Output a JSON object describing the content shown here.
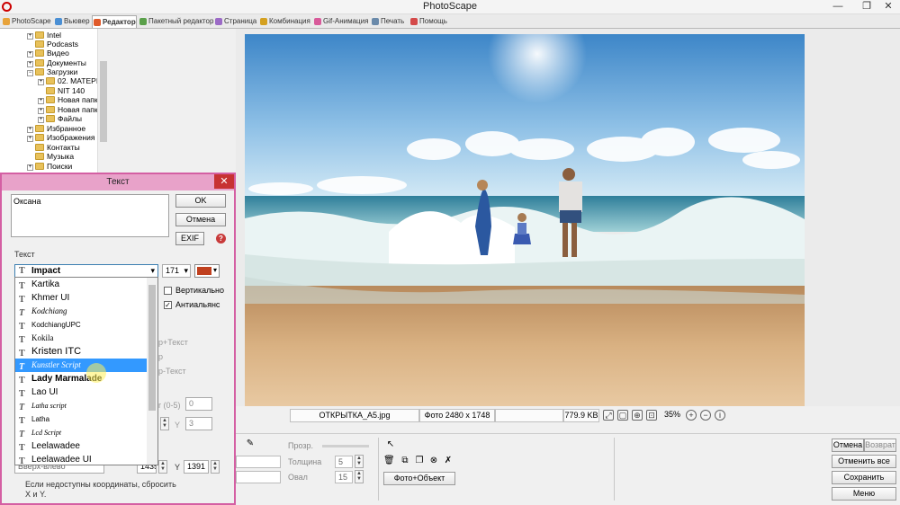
{
  "window": {
    "title": "PhotoScape",
    "minimize": "—",
    "maximize": "❐",
    "close": "✕"
  },
  "tabs": [
    {
      "label": "PhotoScape",
      "icon": "photoscape-icon"
    },
    {
      "label": "Вьювер",
      "icon": "viewer-icon"
    },
    {
      "label": "Редактор",
      "icon": "editor-icon",
      "active": true
    },
    {
      "label": "Пакетный редактор",
      "icon": "batch-icon"
    },
    {
      "label": "Страница",
      "icon": "page-icon"
    },
    {
      "label": "Комбинация",
      "icon": "combine-icon"
    },
    {
      "label": "Gif-Анимация",
      "icon": "gif-icon"
    },
    {
      "label": "Печать",
      "icon": "print-icon"
    },
    {
      "label": "Помощь",
      "icon": "help-icon"
    }
  ],
  "tree": [
    {
      "label": "Intel",
      "expander": "+"
    },
    {
      "label": "Podcasts",
      "expander": ""
    },
    {
      "label": "Видео",
      "expander": "+"
    },
    {
      "label": "Документы",
      "expander": "+"
    },
    {
      "label": "Загрузки",
      "expander": "−"
    },
    {
      "label": "02. MATEPI",
      "expander": "+"
    },
    {
      "label": "NIT 140",
      "expander": ""
    },
    {
      "label": "Новая папк",
      "expander": "+"
    },
    {
      "label": "Новая папк",
      "expander": "+"
    },
    {
      "label": "Файлы",
      "expander": "+"
    },
    {
      "label": "Избранное",
      "expander": "+"
    },
    {
      "label": "Изображения",
      "expander": "+"
    },
    {
      "label": "Контакты",
      "expander": ""
    },
    {
      "label": "Музыка",
      "expander": ""
    },
    {
      "label": "Поиски",
      "expander": "+"
    }
  ],
  "status": {
    "filename": "ОТКРЫТКА_А5.jpg",
    "dimensions": "Фото 2480 x 1748",
    "filesize": "779.9 KB",
    "zoom": "35%"
  },
  "bottom": {
    "transparency_label": "Прозр.",
    "thickness_label": "Толщина",
    "thickness_value": "5",
    "oval_label": "Овал",
    "oval_value": "15",
    "photo_object_button": "Фото+Объект",
    "undo_button": "Отмена",
    "redo_button": "Возврат",
    "undo_all_button": "Отменить все",
    "save_button": "Сохранить",
    "menu_button": "Меню"
  },
  "dialog": {
    "title": "Текст",
    "close": "✕",
    "text_value": "Оксана",
    "ok_button": "OK",
    "cancel_button": "Отмена",
    "exif_button": "EXIF",
    "help_icon": "?",
    "section_label": "Текст",
    "font_value": "Impact",
    "size_value": "171",
    "color": "#c0401e",
    "vertical_label": "Вертикально",
    "antialias_label": "Антиальянс",
    "vertical_checked": false,
    "antialias_checked": true,
    "behind_text_1": "р+Текст",
    "behind_text_2": "р",
    "behind_text_3": "р-Текст",
    "range_label": "r (0-5)",
    "range_value": "0",
    "y_label_1": "Y",
    "y_value_1": "3",
    "position_value": "Вверх-влево",
    "x_value": "1435",
    "y_label_2": "Y",
    "y_value_2": "1391",
    "note": "Если недоступны координаты, сбросить X и Y."
  },
  "fonts": [
    {
      "label": "Kartika"
    },
    {
      "label": "Khmer UI"
    },
    {
      "label": "Kodchiang"
    },
    {
      "label": "KodchiangUPC"
    },
    {
      "label": "Kokila"
    },
    {
      "label": "Kristen ITC"
    },
    {
      "label": "Kunstler Script",
      "selected": true
    },
    {
      "label": "Lady Marmalade"
    },
    {
      "label": "Lao UI"
    },
    {
      "label": "Latha script"
    },
    {
      "label": "Latha"
    },
    {
      "label": "Lcd Script"
    },
    {
      "label": "Leelawadee"
    },
    {
      "label": "Leelawadee UI"
    }
  ]
}
